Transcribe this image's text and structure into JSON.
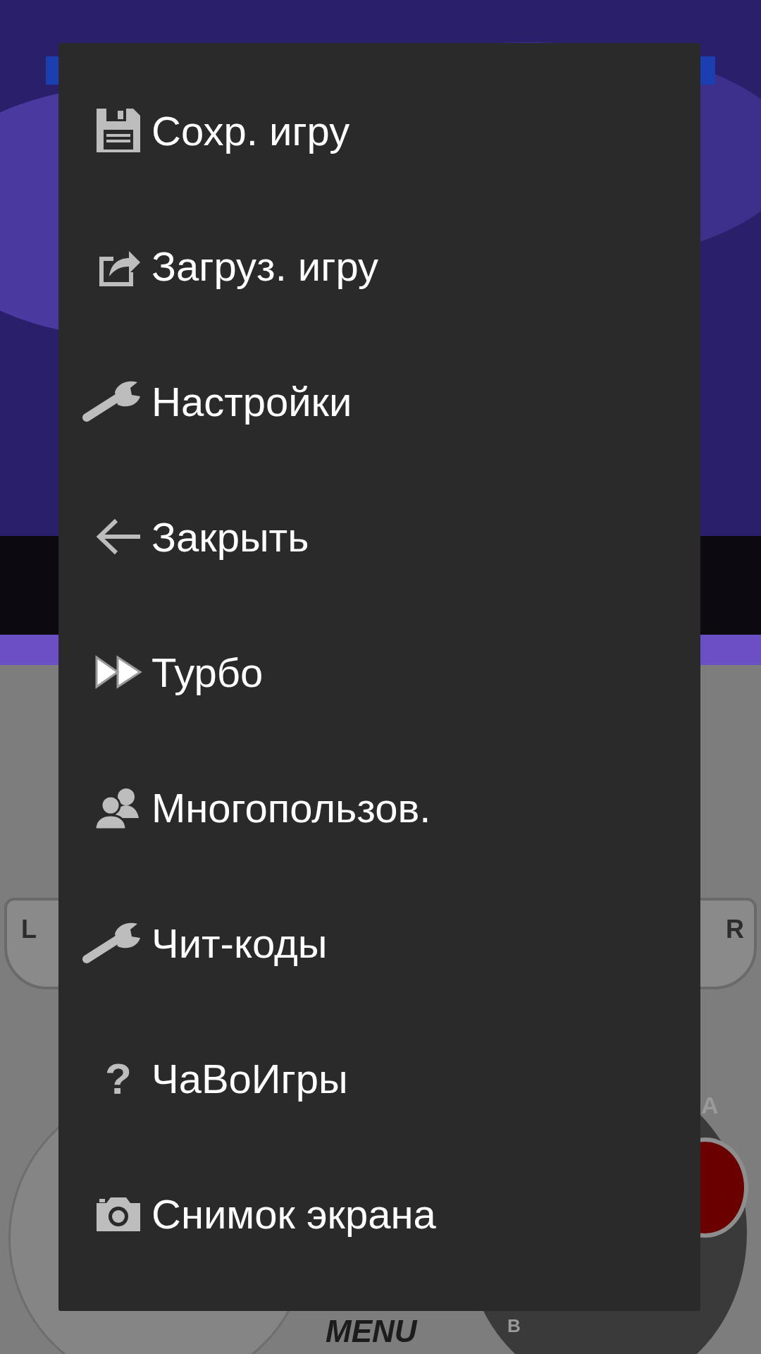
{
  "controller": {
    "l": "L",
    "r": "R",
    "a": "A",
    "b": "B",
    "menu": "MENU"
  },
  "menu": {
    "items": [
      {
        "kind": "floppy",
        "label": "Сохр. игру"
      },
      {
        "kind": "load",
        "label": "Загруз. игру"
      },
      {
        "kind": "wrench",
        "label": "Настройки"
      },
      {
        "kind": "back-arrow",
        "label": "Закрыть"
      },
      {
        "kind": "fast-forward",
        "label": "Турбо"
      },
      {
        "kind": "people",
        "label": "Многопользов."
      },
      {
        "kind": "wrench",
        "label": "Чит-коды"
      },
      {
        "kind": "glyph",
        "glyph": "?",
        "label": "ЧаВоИгры"
      },
      {
        "kind": "camera",
        "label": "Снимок экрана"
      }
    ]
  }
}
